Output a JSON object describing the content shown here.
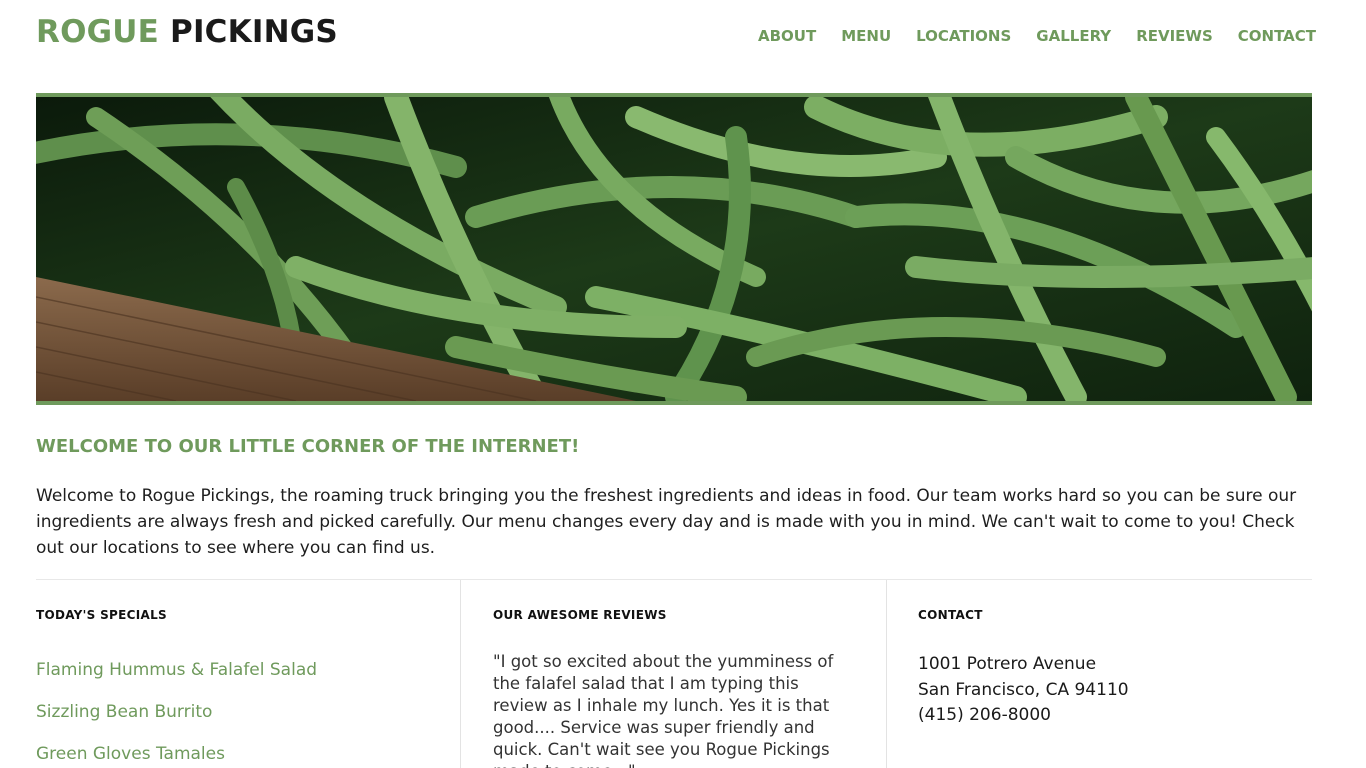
{
  "brand": {
    "part1": "ROGUE",
    "part2": "PICKINGS",
    "accent_color": "#6f9a5c"
  },
  "nav": {
    "items": [
      "ABOUT",
      "MENU",
      "LOCATIONS",
      "GALLERY",
      "REVIEWS",
      "CONTACT"
    ]
  },
  "hero": {
    "image_subject": "green beans in a wooden crate"
  },
  "welcome": {
    "title": "WELCOME TO OUR LITTLE CORNER OF THE INTERNET!",
    "body": "Welcome to Rogue Pickings, the roaming truck bringing you the freshest ingredients and ideas in food. Our team works hard so you can be sure our ingredients are always fresh and picked carefully. Our menu changes every day and is made with you in mind. We can't wait to come to you! Check out our locations to see where you can find us."
  },
  "specials": {
    "title": "TODAY'S SPECIALS",
    "items": [
      "Flaming Hummus & Falafel Salad",
      "Sizzling Bean Burrito",
      "Green Gloves Tamales"
    ]
  },
  "reviews": {
    "title": "OUR AWESOME REVIEWS",
    "quote": "\"I got so excited about the yumminess of the falafel salad that I am typing this review as I inhale my lunch. Yes it is that good.... Service was super friendly and quick. Can't wait see you Rogue Pickings made to come...\""
  },
  "contact": {
    "title": "CONTACT",
    "address1": "1001 Potrero Avenue",
    "address2": "San Francisco, CA 94110",
    "phone": "(415) 206-8000"
  }
}
